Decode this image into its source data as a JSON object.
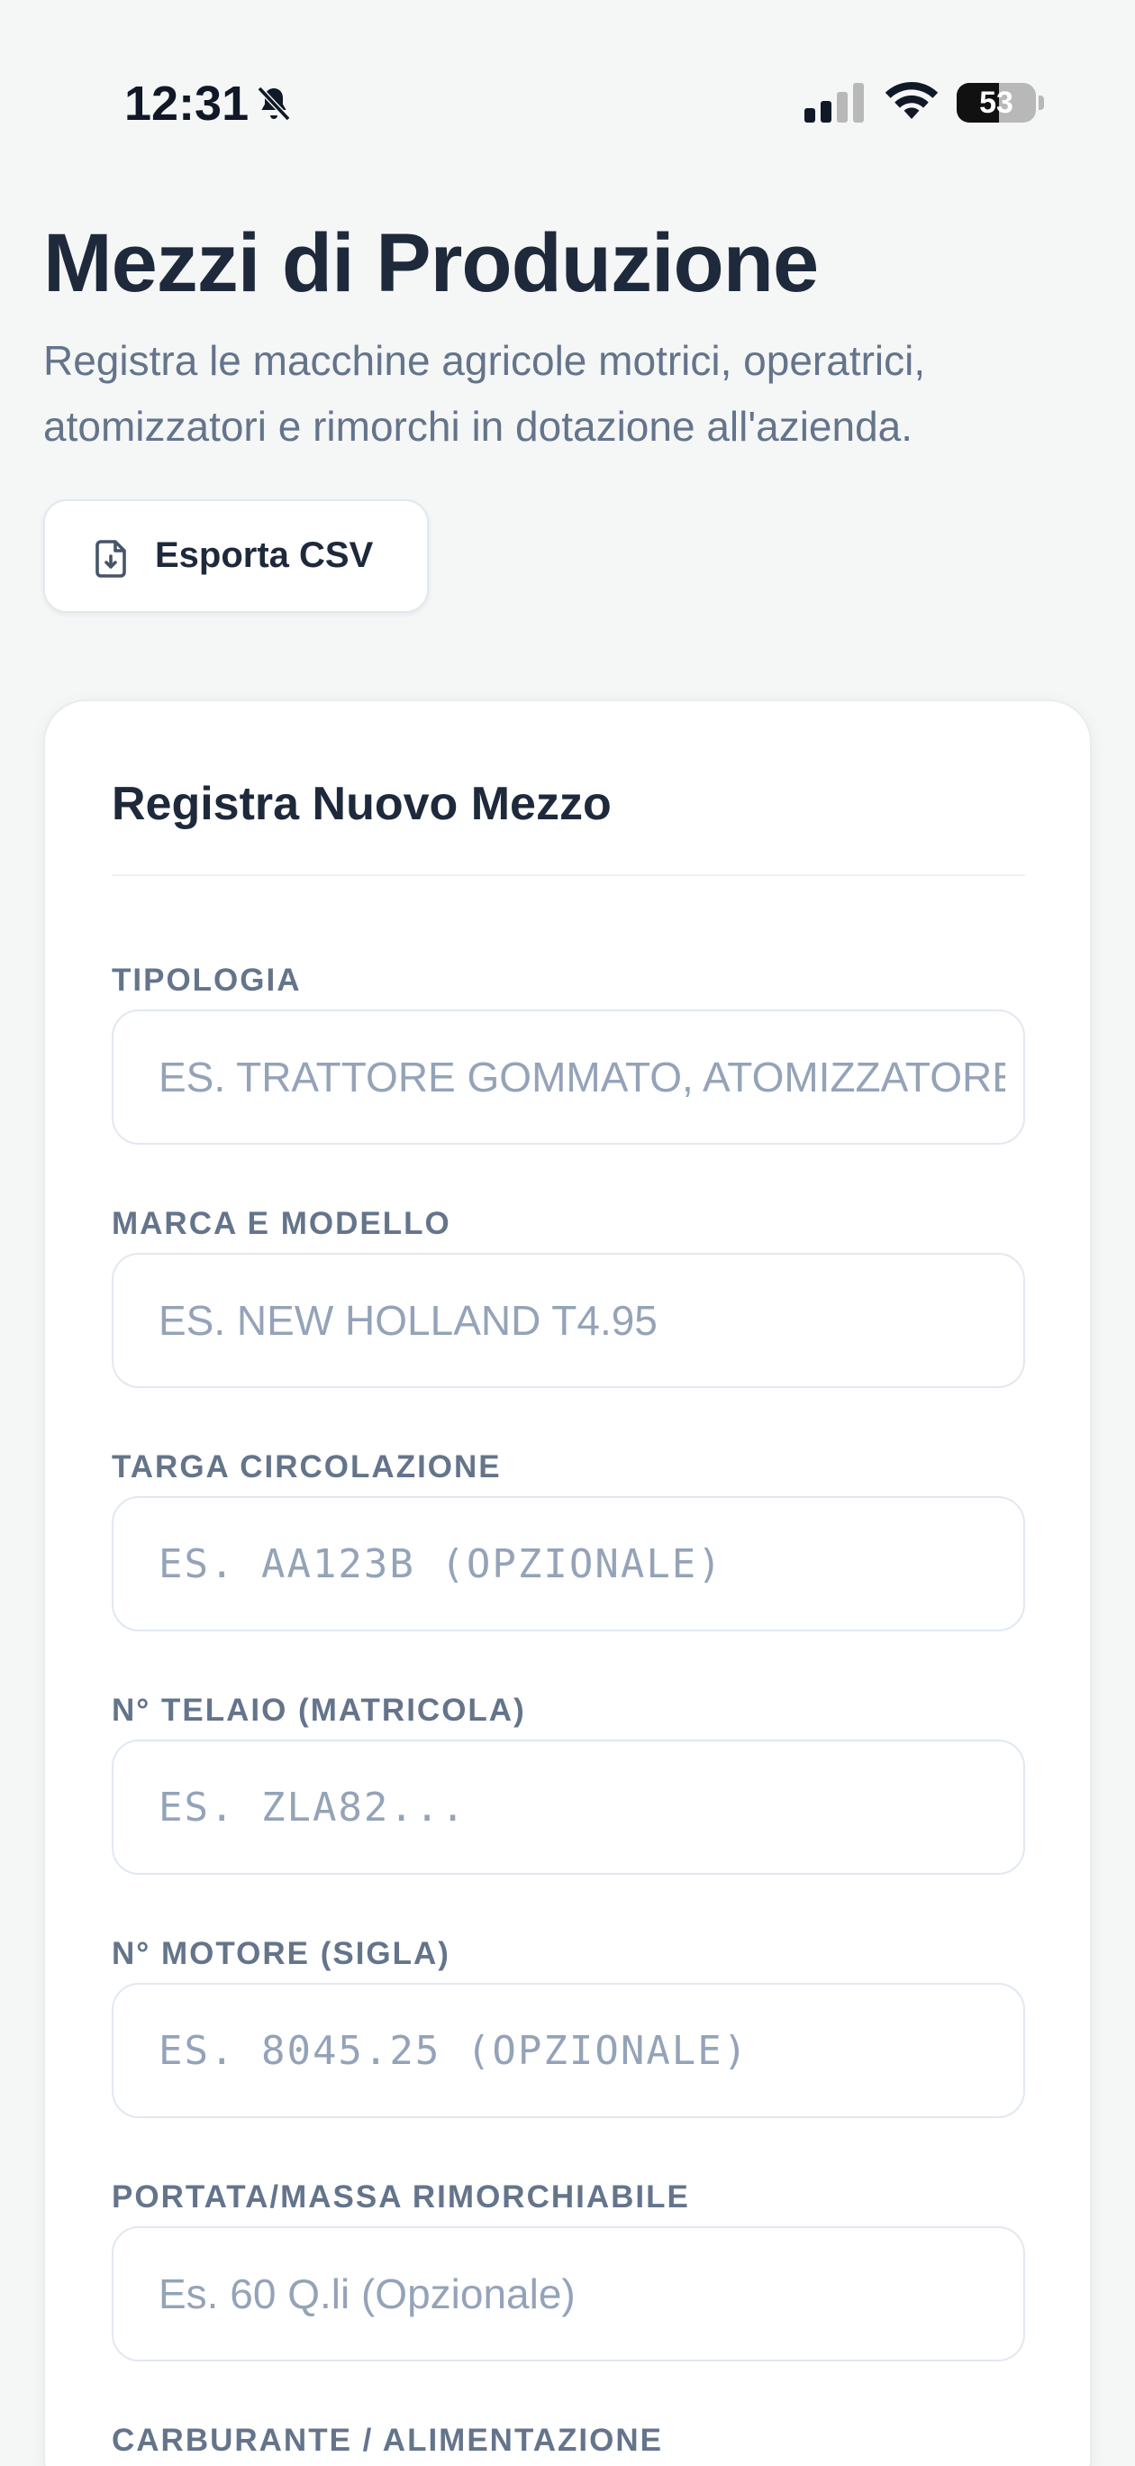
{
  "status_bar": {
    "time": "12:31",
    "battery_level": "53",
    "battery_fraction": 0.53
  },
  "header": {
    "title": "Mezzi di Produzione",
    "subtitle": "Registra le macchine agricole motrici, operatrici, atomizzatori e rimorchi in dotazione all'azienda."
  },
  "toolbar": {
    "export_label": "Esporta CSV",
    "export_icon": "file-download-icon"
  },
  "form": {
    "title": "Registra Nuovo Mezzo",
    "fields": [
      {
        "label": "TIPOLOGIA",
        "placeholder": "Es. Trattore gommato, atomizzatore, rimorchio"
      },
      {
        "label": "MARCA E MODELLO",
        "placeholder": "Es. New Holland T4.95"
      },
      {
        "label": "TARGA CIRCOLAZIONE",
        "placeholder": "ES. AA123B (OPZIONALE)"
      },
      {
        "label": "N° TELAIO (MATRICOLA)",
        "placeholder": "ES. ZLA82..."
      },
      {
        "label": "N° MOTORE (SIGLA)",
        "placeholder": "ES. 8045.25 (OPZIONALE)"
      },
      {
        "label": "PORTATA/MASSA RIMORCHIABILE",
        "placeholder": "Es. 60 Q.li (Opzionale)"
      },
      {
        "label": "CARBURANTE / ALIMENTAZIONE"
      }
    ]
  },
  "colors": {
    "background": "#f5f6f6",
    "title": "#1e293b",
    "muted": "#64748b",
    "placeholder": "#94a3b8",
    "border": "#e2e8f0"
  }
}
